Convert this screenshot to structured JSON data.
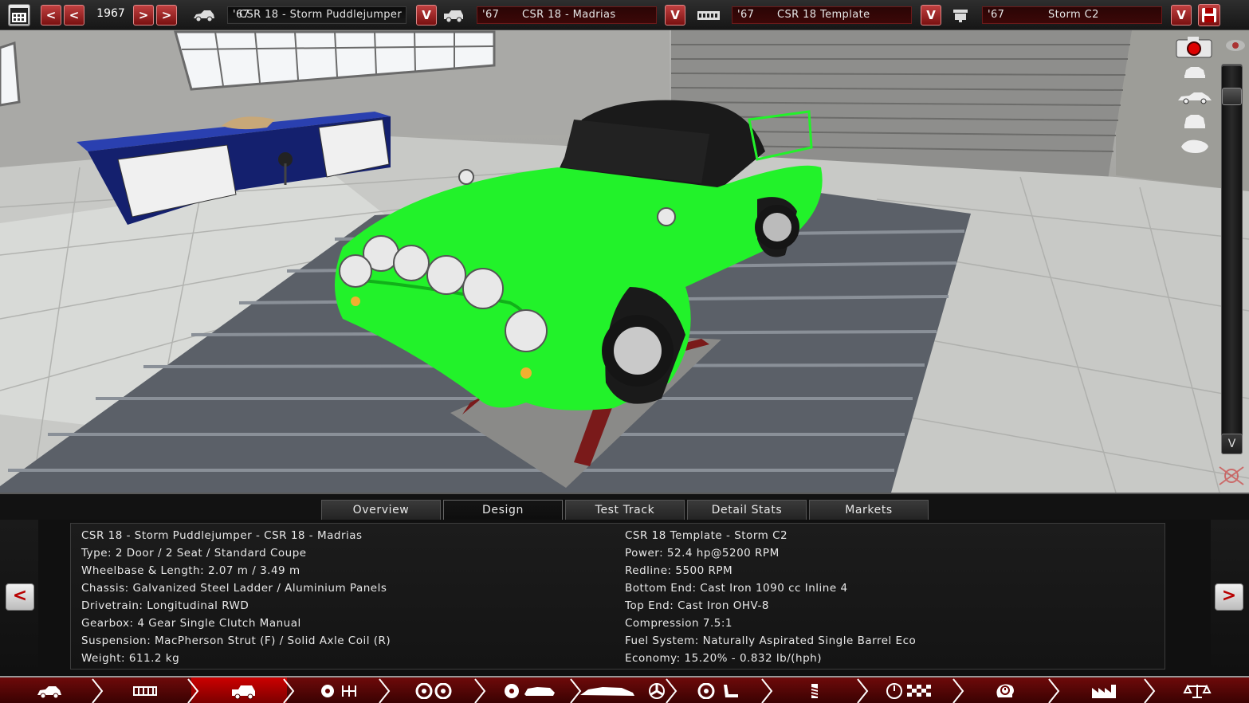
{
  "topbar": {
    "year": "1967",
    "model": {
      "year": "'67",
      "name": "CSR 18 - Storm Puddlejumper"
    },
    "trim": {
      "year": "'67",
      "name": "CSR 18 - Madrias"
    },
    "engine_family": {
      "year": "'67",
      "name": "CSR 18 Template"
    },
    "engine_variant": {
      "year": "'67",
      "name": "Storm C2"
    },
    "prev_label": "<",
    "next_label": ">",
    "dropdown_label": "V"
  },
  "sidebar": {
    "up_label": "^",
    "down_label": "V"
  },
  "tabs": [
    {
      "label": "Overview",
      "active": false
    },
    {
      "label": "Design",
      "active": true
    },
    {
      "label": "Test Track",
      "active": false
    },
    {
      "label": "Detail Stats",
      "active": false
    },
    {
      "label": "Markets",
      "active": false
    }
  ],
  "info": {
    "left": [
      "CSR 18 - Storm Puddlejumper - CSR 18 - Madrias",
      "Type: 2 Door / 2 Seat / Standard Coupe",
      "Wheelbase & Length: 2.07 m / 3.49 m",
      "Chassis: Galvanized Steel Ladder / Aluminium Panels",
      "Drivetrain: Longitudinal RWD",
      "Gearbox: 4 Gear Single Clutch Manual",
      "Suspension: MacPherson Strut (F) / Solid Axle Coil (R)",
      "Weight: 611.2 kg"
    ],
    "right": [
      "CSR 18 Template - Storm C2",
      "Power: 52.4 hp@5200 RPM",
      "Redline: 5500 RPM",
      "Bottom End: Cast Iron 1090 cc Inline 4",
      "Top End: Cast Iron OHV-8",
      "Compression 7.5:1",
      "Fuel System: Naturally Aspirated Single Barrel Eco",
      "Economy: 15.20% - 0.832 lb/(hph)"
    ],
    "prev_label": "<",
    "next_label": ">"
  },
  "bottom_nav": [
    {
      "icon": "car-model-icon",
      "active": false
    },
    {
      "icon": "chassis-frame-icon",
      "active": false
    },
    {
      "icon": "car-body-icon",
      "active": true
    },
    {
      "icon": "suspension-gear-icon",
      "active": false
    },
    {
      "icon": "wheels-icon",
      "active": false
    },
    {
      "icon": "brakes-icon",
      "active": false
    },
    {
      "icon": "aero-fan-icon",
      "active": false
    },
    {
      "icon": "interior-seat-icon",
      "active": false
    },
    {
      "icon": "shock-absorber-icon",
      "active": false
    },
    {
      "icon": "test-gauge-flag-icon",
      "active": false
    },
    {
      "icon": "engineering-time-icon",
      "active": false
    },
    {
      "icon": "factory-icon",
      "active": false
    },
    {
      "icon": "scale-icon",
      "active": false
    }
  ],
  "colors": {
    "car_body": "#22f22a",
    "accent_red": "#8a0a0a",
    "nav_active": "#c00000"
  }
}
